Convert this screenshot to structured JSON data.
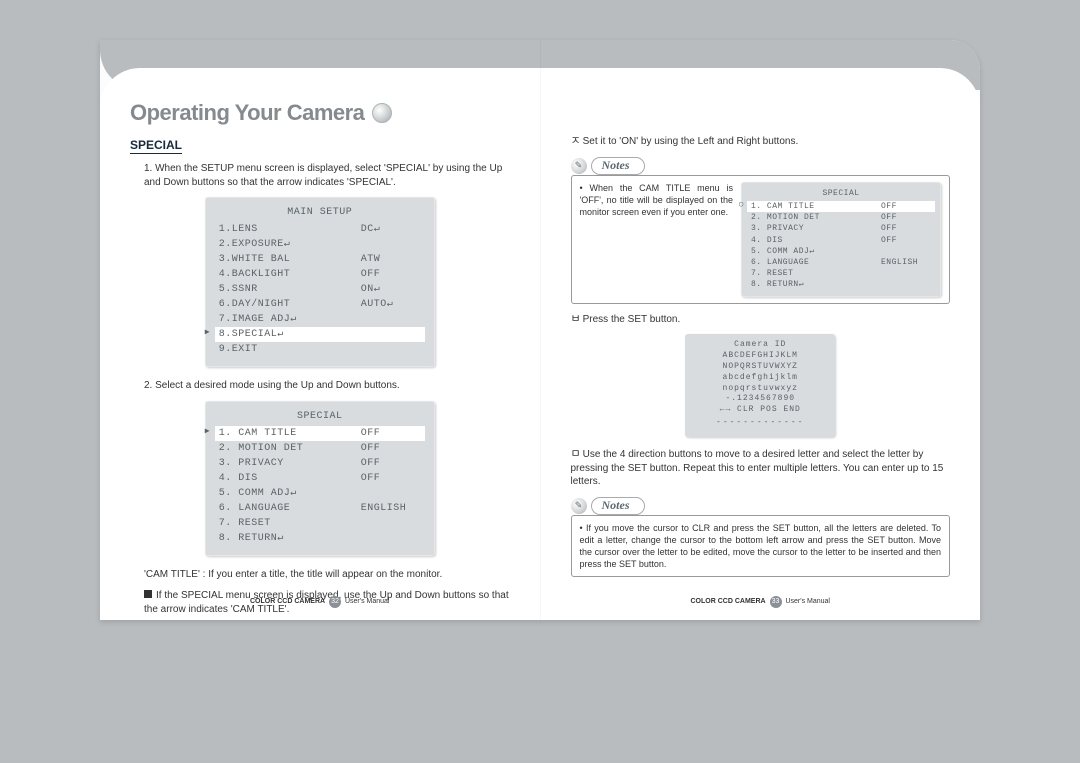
{
  "heading": "Operating Your Camera",
  "section_label": "SPECIAL",
  "left": {
    "step1": "1. When the SETUP menu screen is displayed, select 'SPECIAL' by using the Up and Down buttons so that the arrow indicates 'SPECIAL'.",
    "main_setup": {
      "title": "MAIN SETUP",
      "rows": [
        {
          "k": "1.LENS",
          "v": "DC↵"
        },
        {
          "k": "2.EXPOSURE↵",
          "v": ""
        },
        {
          "k": "3.WHITE BAL",
          "v": "ATW"
        },
        {
          "k": "4.BACKLIGHT",
          "v": "OFF"
        },
        {
          "k": "5.SSNR",
          "v": "ON↵"
        },
        {
          "k": "6.DAY/NIGHT",
          "v": "AUTO↵"
        },
        {
          "k": "7.IMAGE ADJ↵",
          "v": ""
        },
        {
          "k": "8.SPECIAL↵",
          "v": "",
          "hl": true
        },
        {
          "k": "9.EXIT",
          "v": ""
        }
      ]
    },
    "step2": "2. Select a desired mode using the Up and Down buttons.",
    "special_menu": {
      "title": "SPECIAL",
      "rows": [
        {
          "k": "1. CAM TITLE",
          "v": "OFF",
          "hl": true
        },
        {
          "k": "2. MOTION DET",
          "v": "OFF"
        },
        {
          "k": "3. PRIVACY",
          "v": "OFF"
        },
        {
          "k": "4. DIS",
          "v": "OFF"
        },
        {
          "k": "5. COMM ADJ↵",
          "v": ""
        },
        {
          "k": "6. LANGUAGE",
          "v": "ENGLISH"
        },
        {
          "k": "7. RESET",
          "v": ""
        },
        {
          "k": "8. RETURN↵",
          "v": ""
        }
      ]
    },
    "cam_title_line": "'CAM TITLE' : If you enter a title, the title will appear on the monitor.",
    "bullet": "If the SPECIAL menu screen is displayed, use the Up and Down buttons so that the arrow indicates 'CAM TITLE'."
  },
  "right": {
    "step_g": "Set it to 'ON' by using the Left and Right buttons.",
    "notes1": "When the CAM TITLE menu is 'OFF', no title will be displayed on the monitor screen even if you enter one.",
    "special_small": {
      "title": "SPECIAL",
      "rows": [
        {
          "k": "1. CAM TITLE",
          "v": "OFF",
          "hl": true
        },
        {
          "k": "2. MOTION DET",
          "v": "OFF"
        },
        {
          "k": "3. PRIVACY",
          "v": "OFF"
        },
        {
          "k": "4. DIS",
          "v": "OFF"
        },
        {
          "k": "5. COMM ADJ↵",
          "v": ""
        },
        {
          "k": "6. LANGUAGE",
          "v": "ENGLISH"
        },
        {
          "k": "7. RESET",
          "v": ""
        },
        {
          "k": "8. RETURN↵",
          "v": ""
        }
      ]
    },
    "step_h": "Press the SET button.",
    "camera_id": {
      "title": "Camera ID",
      "l1": "ABCDEFGHIJKLM",
      "l2": "NOPQRSTUVWXYZ",
      "l3": "abcdefghijklm",
      "l4": "nopqrstuvwxyz",
      "l5": "-.1234567890",
      "l6": "←→  CLR  POS  END",
      "dashes": "-------------"
    },
    "step_i": "Use the 4 direction buttons to move to a desired letter and select the letter by pressing the SET button. Repeat this to enter multiple letters. You can enter up to 15 letters.",
    "notes2": "If you move the cursor to CLR and press the SET button, all the letters are deleted. To edit a letter, change the cursor to the bottom left arrow and press the SET button. Move the cursor over the letter to be edited, move the cursor to the letter to be inserted and then press the SET button."
  },
  "notes_label": "Notes",
  "footer": {
    "product": "COLOR CCD CAMERA",
    "label": "User's Manual",
    "page_left": "32",
    "page_right": "33"
  }
}
